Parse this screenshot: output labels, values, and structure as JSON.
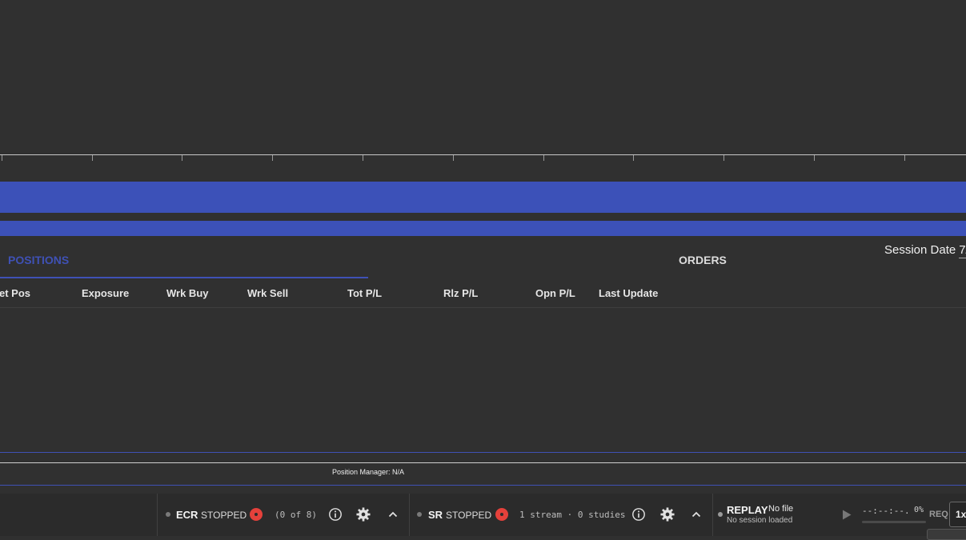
{
  "tabs": [
    {
      "label": "POSITIONS",
      "active": true
    },
    {
      "label": "ORDERS",
      "active": false
    }
  ],
  "session": {
    "label": "Session Date",
    "value": "7/"
  },
  "columns": [
    "et Pos",
    "Exposure",
    "Wrk Buy",
    "Wrk Sell",
    "Tot P/L",
    "Rlz P/L",
    "Opn P/L",
    "Last Update"
  ],
  "position_manager": {
    "label": "Position Manager: N/A"
  },
  "ecr": {
    "label": "ECR",
    "status": "STOPPED",
    "count": "(0 of 8)"
  },
  "sr": {
    "label": "SR",
    "status": "STOPPED",
    "info": "1 stream · 0 studies"
  },
  "replay": {
    "label": "REPLAY",
    "file": "No file",
    "session": "No session loaded",
    "time": "--:--:--.",
    "progress": "0%",
    "req": "REQ",
    "speed": "1x"
  },
  "colors": {
    "accent": "#3f51b5",
    "record": "#e5413b",
    "background": "#303030"
  }
}
